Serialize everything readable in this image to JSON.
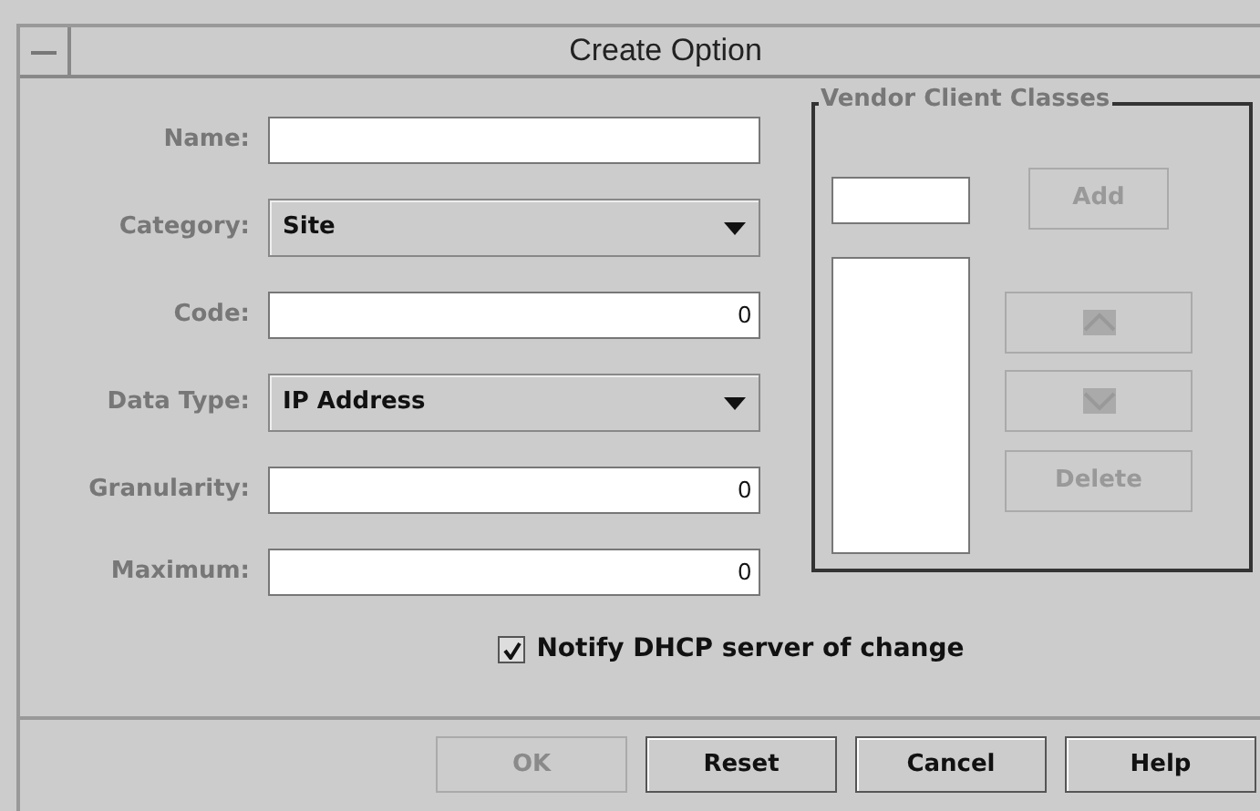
{
  "window": {
    "title": "Create Option"
  },
  "fields": [
    {
      "label": "Name:",
      "kind": "text"
    },
    {
      "label": "Category:",
      "kind": "dropdown",
      "value": "Site"
    },
    {
      "label": "Code:",
      "kind": "text",
      "value": "0"
    },
    {
      "label": "Data Type:",
      "kind": "dropdown",
      "value": "IP Address"
    },
    {
      "label": "Granularity:",
      "kind": "text",
      "value": "0"
    },
    {
      "label": "Maximum:",
      "kind": "text",
      "value": "0"
    }
  ],
  "vendor_client_classes": {
    "title": "Vendor Client Classes",
    "add_button": {
      "label": "Add",
      "disabled": true
    },
    "move_buttons": [
      {
        "kind": "up",
        "disabled": true
      },
      {
        "kind": "down",
        "disabled": true
      }
    ],
    "delete_button": {
      "label": "Delete",
      "disabled": true
    }
  },
  "notify_checkbox": {
    "label": "Notify DHCP server of change",
    "checked": true
  },
  "buttons": [
    {
      "label": "OK",
      "disabled": true
    },
    {
      "label": "Reset",
      "disabled": false
    },
    {
      "label": "Cancel",
      "disabled": false
    },
    {
      "label": "Help",
      "disabled": false
    }
  ]
}
